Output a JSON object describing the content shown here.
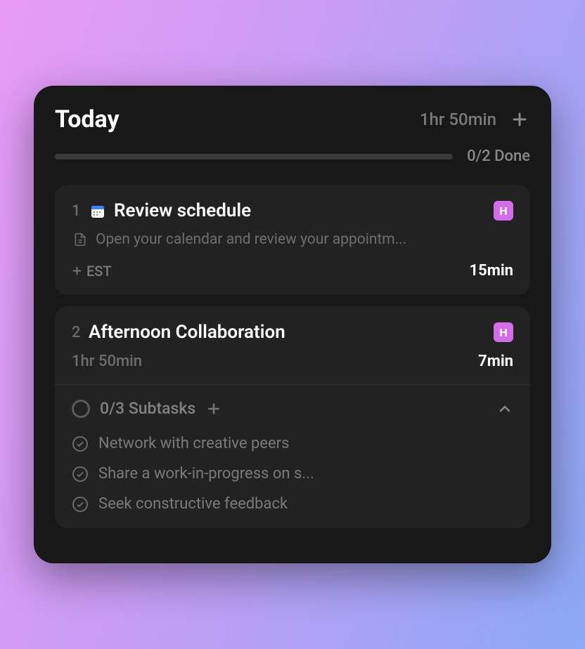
{
  "header": {
    "title": "Today",
    "total_time": "1hr 50min"
  },
  "progress": {
    "label": "0/2 Done",
    "percent": 0
  },
  "tasks": [
    {
      "num": "1",
      "icon": "calendar",
      "title": "Review schedule",
      "badge": "H",
      "description": "Open your calendar and review your appointm...",
      "est_label": "EST",
      "time": "15min"
    },
    {
      "num": "2",
      "title": "Afternoon Collaboration",
      "badge": "H",
      "meta_left": "1hr 50min",
      "time": "7min",
      "subtasks_label": "0/3 Subtasks",
      "subtasks": [
        "Network with creative peers",
        "Share a work-in-progress on s...",
        "Seek constructive feedback"
      ]
    }
  ]
}
